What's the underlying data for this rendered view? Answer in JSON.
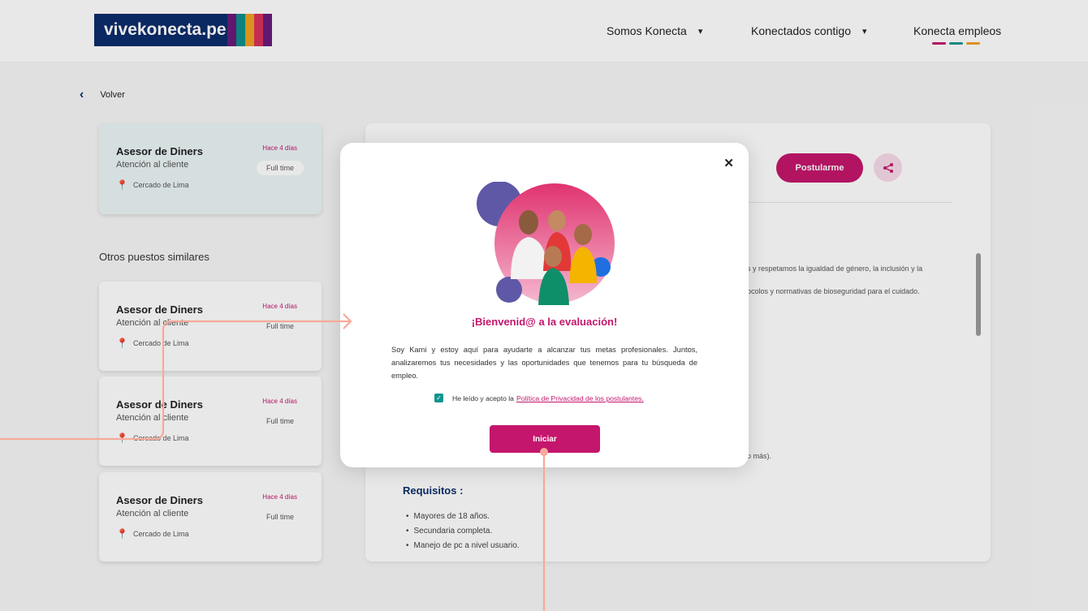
{
  "header": {
    "logo_text": "vivekonecta.pe",
    "nav": [
      {
        "label": "Somos Konecta"
      },
      {
        "label": "Konectados contigo"
      },
      {
        "label": "Konecta empleos"
      }
    ],
    "chevron": "⌄"
  },
  "back_label": "Volver",
  "active_card": {
    "title": "Asesor de Diners",
    "subtitle": "Atención al cliente",
    "location": "Cercado de Lima",
    "date": "Hace 4 días",
    "type": "Full time"
  },
  "similar_title": "Otros puestos similares",
  "similar_cards": [
    {
      "title": "Asesor de Diners",
      "subtitle": "Atención al cliente",
      "location": "Cercado de Lima",
      "date": "Hace 4 días",
      "type": "Full time"
    },
    {
      "title": "Asesor de Diners",
      "subtitle": "Atención al cliente",
      "location": "Cercado de Lima",
      "date": "Hace 4 días",
      "type": "Full time"
    },
    {
      "title": "Asesor de Diners",
      "subtitle": "Atención al cliente",
      "location": "Cercado de Lima",
      "date": "Hace 4 días",
      "type": "Full time"
    }
  ],
  "detail": {
    "apply_label": "Postularme",
    "text_line1": "s y respetamos la igualdad de género, la inclusión y la",
    "text_line2": "ocolos y normativas de bioseguridad para el cuidado.",
    "text_line3": "o más).",
    "requirements_title": "Requisitos :",
    "requirements": [
      "Mayores de 18 años.",
      "Secundaria completa.",
      "Manejo de pc a nivel usuario."
    ]
  },
  "modal": {
    "close": "✕",
    "welcome": "¡Bienvenid@ a la evaluación!",
    "intro": "Soy Kami y estoy aquí para ayudarte a alcanzar tus metas profesionales. Juntos, analizaremos tus necesidades y las oportunidades que tenemos para tu búsqueda de empleo.",
    "consent_text": "He leído y acepto la",
    "consent_link": "Política de Privacidad de los postulantes.",
    "checkbox_checked": true,
    "start_label": "Iniciar"
  },
  "colors": {
    "brand_magenta": "#c4166c",
    "navy": "#0c2d6b",
    "teal": "#10958f",
    "annotation": "#f7a99a",
    "logo_stripes": [
      "#6a1b7a",
      "#0e8f8a",
      "#f0a020",
      "#d8315b",
      "#6a1b7a"
    ],
    "nav_bars": [
      "#c4166c",
      "#10958f",
      "#f0a020"
    ]
  },
  "icons": {
    "pin": "⬤",
    "share": "share-icon",
    "check": "✓",
    "back": "❮"
  }
}
